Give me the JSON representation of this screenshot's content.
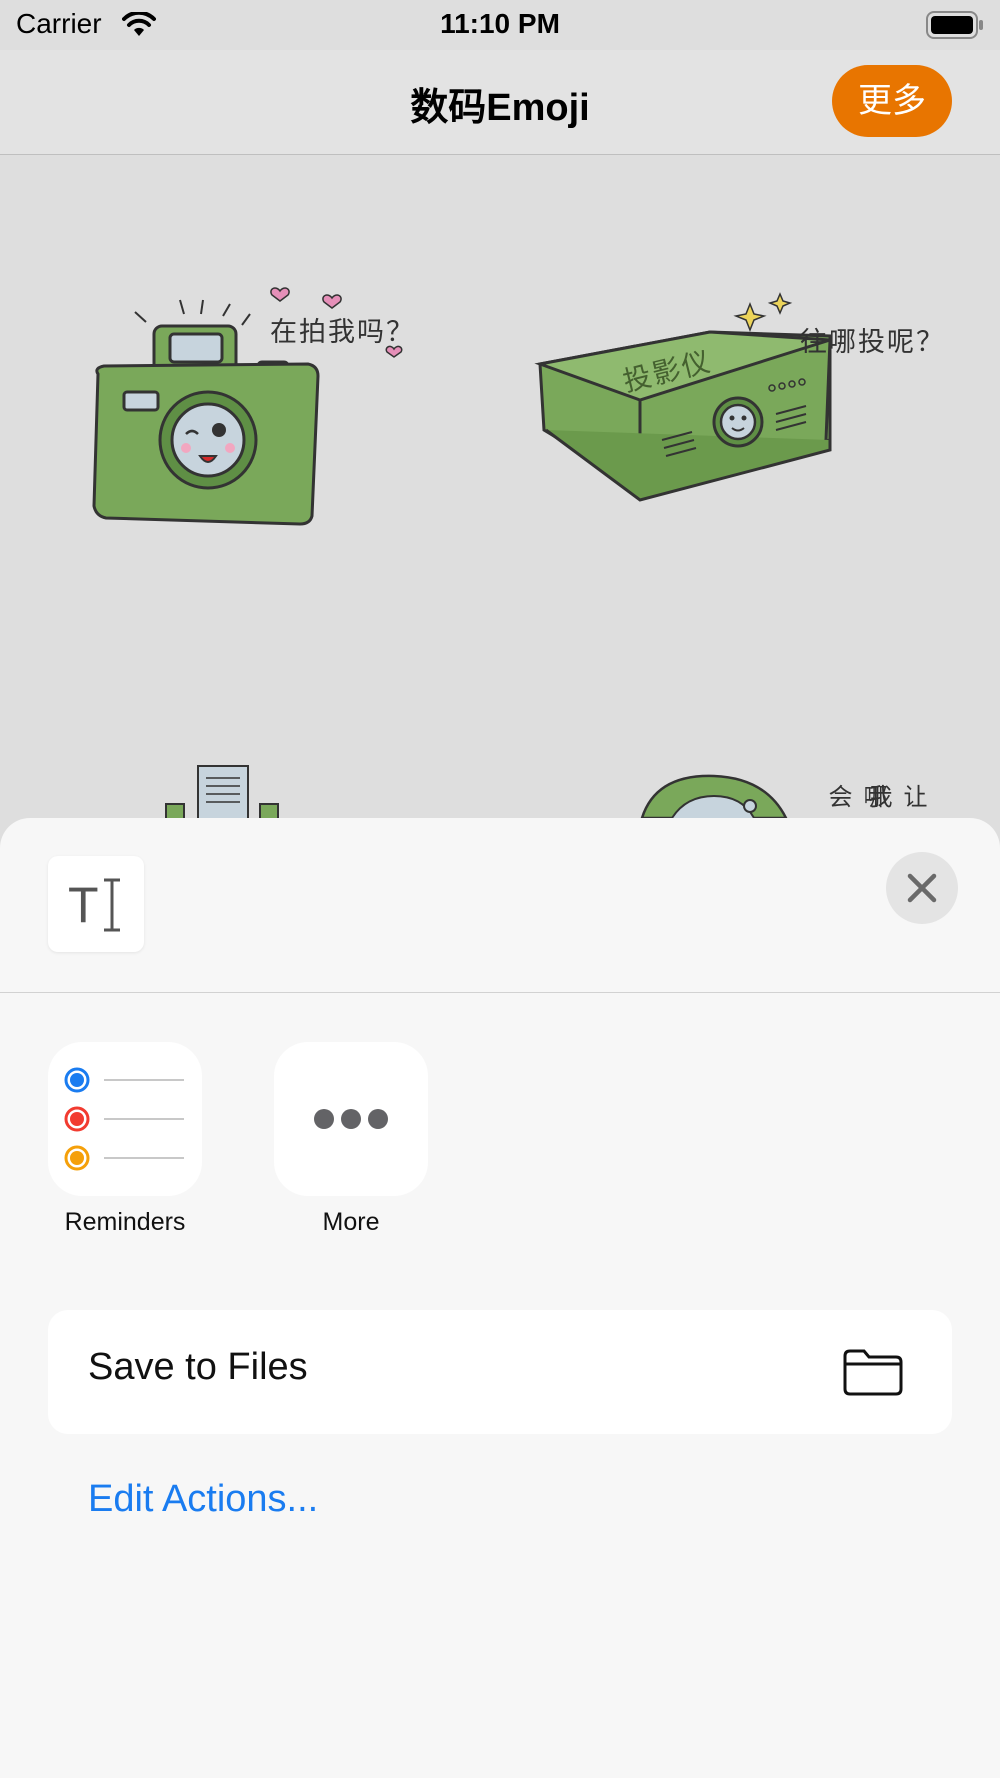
{
  "status_bar": {
    "carrier": "Carrier",
    "time": "11:10 PM"
  },
  "nav": {
    "title": "数码Emoji",
    "more_button": "更多"
  },
  "stickers": [
    {
      "name": "camera",
      "caption": "在拍我吗？"
    },
    {
      "name": "projector",
      "caption": "往哪投呢？",
      "body_text": "投影仪"
    },
    {
      "name": "document-robot",
      "caption": ""
    },
    {
      "name": "speaker",
      "caption_col1": "哪会",
      "caption_col2": "让我"
    }
  ],
  "share_sheet": {
    "apps": [
      {
        "label": "Reminders",
        "icon": "reminders-icon"
      },
      {
        "label": "More",
        "icon": "more-dots-icon"
      }
    ],
    "actions": [
      {
        "label": "Save to Files",
        "icon": "folder-icon"
      }
    ],
    "edit_actions": "Edit Actions..."
  },
  "colors": {
    "accent": "#e87500",
    "link": "#1a7cf0",
    "sticker_green": "#7aa85a",
    "background": "#dedede"
  }
}
